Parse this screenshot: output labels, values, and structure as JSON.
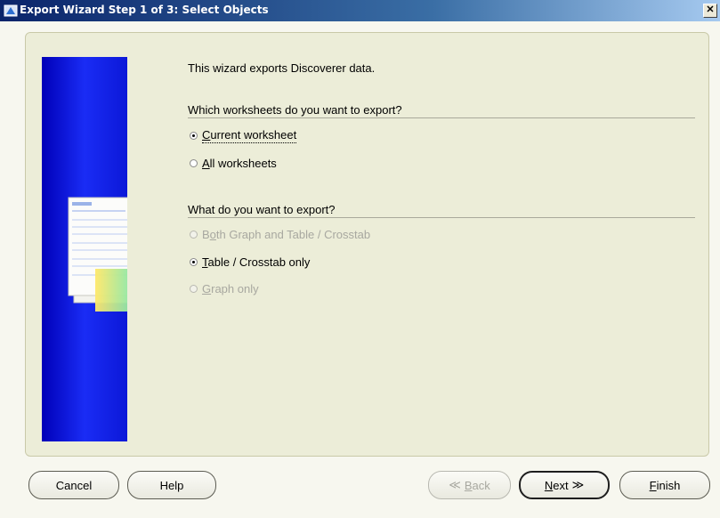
{
  "window": {
    "title": "Export Wizard Step 1 of 3: Select Objects",
    "close_glyph": "✕",
    "app_icon": "discoverer-icon"
  },
  "intro_text": "This wizard exports Discoverer data.",
  "worksheets_section": {
    "title": "Which worksheets do you want to export?",
    "options": [
      {
        "label_mnemonic": "C",
        "label_rest": "urrent worksheet",
        "selected": true,
        "enabled": true
      },
      {
        "label_mnemonic": "A",
        "label_rest": "ll worksheets",
        "selected": false,
        "enabled": true
      }
    ]
  },
  "export_section": {
    "title": "What do you want to export?",
    "options": [
      {
        "label_pre": "B",
        "label_mnemonic": "o",
        "label_rest": "th Graph and Table / Crosstab",
        "selected": false,
        "enabled": false
      },
      {
        "label_pre": "",
        "label_mnemonic": "T",
        "label_rest": "able / Crosstab only",
        "selected": true,
        "enabled": true
      },
      {
        "label_pre": "",
        "label_mnemonic": "G",
        "label_rest": "raph only",
        "selected": false,
        "enabled": false
      }
    ]
  },
  "buttons": {
    "cancel": "Cancel",
    "help": "Help",
    "back_arrow": "≪",
    "back_mnemonic": "B",
    "back_rest": "ack",
    "next_mnemonic": "N",
    "next_rest": "ext",
    "next_arrow": "≫",
    "finish_mnemonic": "F",
    "finish_rest": "inish"
  },
  "colors": {
    "title_bar": "#0a246a",
    "side_panel": "#1a2cf5",
    "disabled_text": "#a8a8a0"
  }
}
